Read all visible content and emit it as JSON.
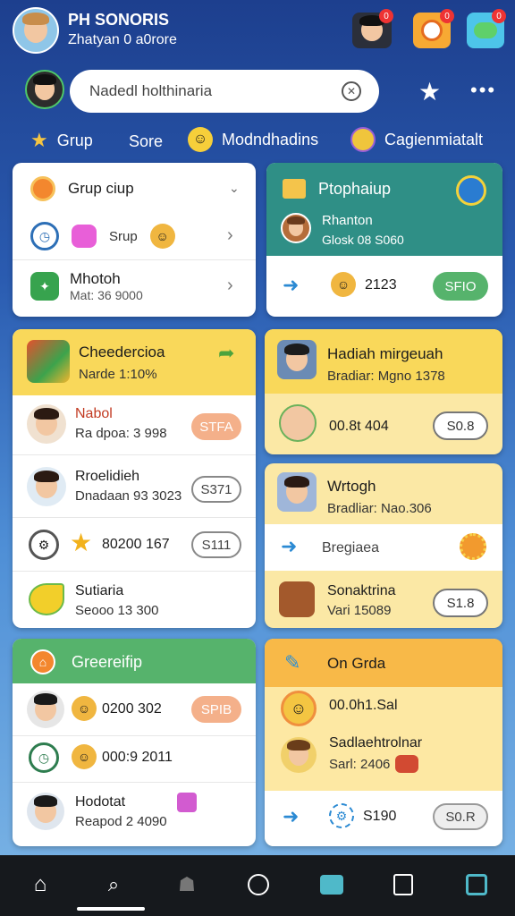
{
  "header": {
    "name": "PH SONORIS",
    "subtitle": "Zhatyan 0 a0rore",
    "badge_1": "0",
    "badge_2": "0",
    "badge_3": "0"
  },
  "search": {
    "value": "Nadedl holthinaria"
  },
  "filters": [
    {
      "label": "Grup"
    },
    {
      "label": "Sore"
    },
    {
      "label": "Modndhadins"
    },
    {
      "label": "Cagienmiatalt"
    }
  ],
  "c1": {
    "title": "Grup ciup",
    "row2": "Srup",
    "row3_title": "Mhotoh",
    "row3_sub": "Mat: 36 9000"
  },
  "c2": {
    "title": "Ptophaiup",
    "name": "Rhanton",
    "sub": "Glosk 08 S060",
    "value": "2123",
    "button": "SFIO"
  },
  "c3": {
    "title": "Cheedercioa",
    "sub": "Narde 1:10%",
    "r1_name": "Nabol",
    "r1_sub": "Ra dpoa: 3 998",
    "r1_btn": "STFA",
    "r2_name": "Rroelidieh",
    "r2_sub": "Dnadaan 93 3023",
    "r2_btn": "S371",
    "r3_text": "80200 167",
    "r3_btn": "S111",
    "r4_name": "Sutiaria",
    "r4_sub": "Seooo 13 300"
  },
  "c4": {
    "title": "Hadiah mirgeuah",
    "sub": "Bradiar: Mgno 1378",
    "r1_text": "00.8t 404",
    "r1_btn": "S0.8"
  },
  "c5": {
    "title": "Wrtogh",
    "sub": "Bradliar: Nao.306",
    "r2_text": "Bregiaea",
    "r3_name": "Sonaktrina",
    "r3_sub": "Vari 15089",
    "r3_btn": "S1.8"
  },
  "c6": {
    "title": "Greereifip",
    "r1_text": "0200 302",
    "r1_btn": "SPIB",
    "r2_text": "000:9 2011",
    "r3_name": "Hodotat",
    "r3_sub": "Reapod 2 4090"
  },
  "c7": {
    "title": "On Grda",
    "r1_text": "00.0h1.Sal",
    "r2_name": "Sadlaehtrolnar",
    "r2_sub": "Sarl: 2406",
    "r3_text": "S190",
    "r3_btn": "S0.R"
  },
  "colors": {
    "yellow": "#f9d85a",
    "green": "#56b36c",
    "teal": "#2f8f86",
    "orange_pill": "#f4b08a"
  }
}
